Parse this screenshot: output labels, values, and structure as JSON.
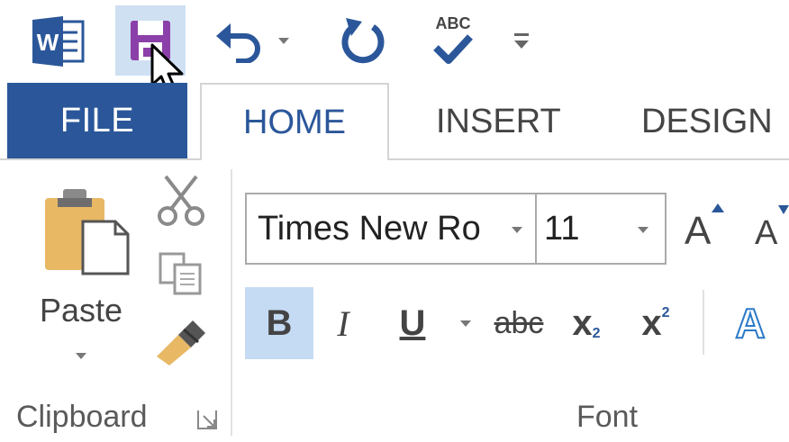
{
  "quick_access": {
    "app_icon": "word-icon",
    "save_icon": "save-icon",
    "undo_icon": "undo-icon",
    "redo_icon": "redo-icon",
    "spelling_icon": "spelling-grammar-icon",
    "spelling_label": "ABC",
    "customize_icon": "customize-toolbar-icon"
  },
  "tabs": {
    "file": "FILE",
    "home": "HOME",
    "insert": "INSERT",
    "design": "DESIGN"
  },
  "clipboard": {
    "paste_label": "Paste",
    "group_label": "Clipboard",
    "cut_icon": "cut-icon",
    "copy_icon": "copy-icon",
    "format_painter_icon": "format-painter-icon"
  },
  "font": {
    "font_name": "Times New Ro",
    "font_size": "11",
    "grow_label": "A",
    "shrink_label": "A",
    "bold_label": "B",
    "italic_label": "I",
    "underline_label": "U",
    "strike_label": "abc",
    "subscript_label": "x",
    "subscript_mark": "2",
    "superscript_label": "x",
    "superscript_mark": "2",
    "text_effects_label": "A",
    "group_label": "Font"
  },
  "colors": {
    "accent": "#2b579a",
    "active_bold_bg": "#c5dbf3",
    "save_purple": "#8b3fa8"
  }
}
